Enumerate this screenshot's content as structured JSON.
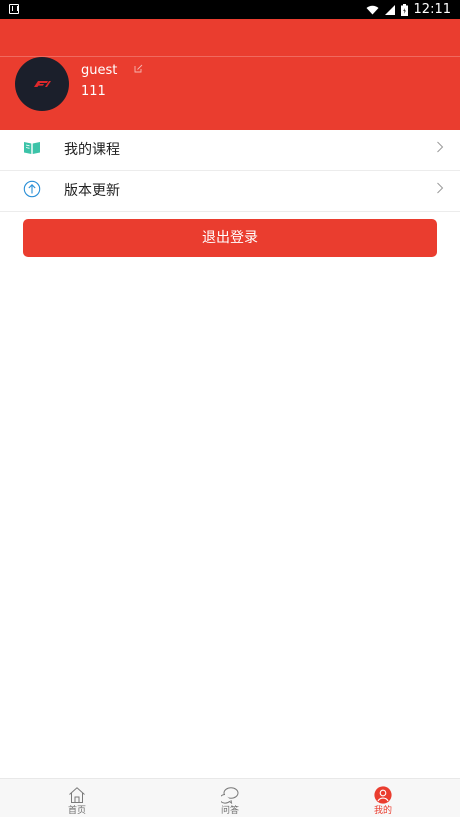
{
  "status_bar": {
    "time": "12:11"
  },
  "profile": {
    "username": "guest",
    "user_id": "111"
  },
  "menu": {
    "items": [
      {
        "label": "我的课程",
        "icon": "book-icon"
      },
      {
        "label": "版本更新",
        "icon": "upload-arrow-icon"
      }
    ]
  },
  "logout_label": "退出登录",
  "tabbar": {
    "tabs": [
      {
        "label": "首页",
        "icon": "home-icon"
      },
      {
        "label": "问答",
        "icon": "chat-icon"
      },
      {
        "label": "我的",
        "icon": "user-icon",
        "active": true
      }
    ]
  },
  "colors": {
    "brand": "#ea3d2f",
    "teal": "#3cc3a8",
    "blue": "#2a8fd6"
  }
}
